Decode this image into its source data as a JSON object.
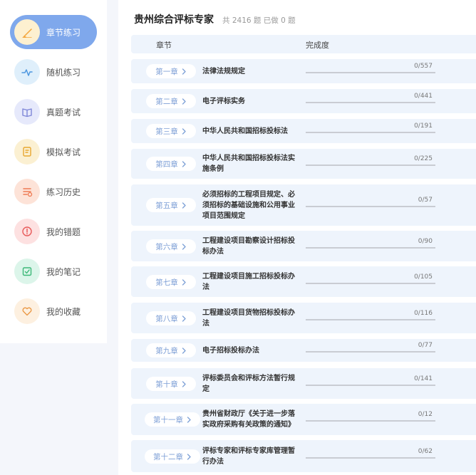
{
  "sidebar": {
    "items": [
      {
        "label": "章节练习",
        "icon": "pencil-icon",
        "active": true,
        "bg": "#fdf0d0",
        "fg": "#f3a43a"
      },
      {
        "label": "随机练习",
        "icon": "pulse-icon",
        "active": false,
        "bg": "#dfeffb",
        "fg": "#4f98e0"
      },
      {
        "label": "真题考试",
        "icon": "book-icon",
        "active": false,
        "bg": "#e6e9fb",
        "fg": "#7e86d8"
      },
      {
        "label": "模拟考试",
        "icon": "edit-document-icon",
        "active": false,
        "bg": "#fbf0d2",
        "fg": "#e8a730"
      },
      {
        "label": "练习历史",
        "icon": "history-list-icon",
        "active": false,
        "bg": "#fde3d8",
        "fg": "#ee7a52"
      },
      {
        "label": "我的错题",
        "icon": "error-icon",
        "active": false,
        "bg": "#fde1e1",
        "fg": "#e85a5a"
      },
      {
        "label": "我的笔记",
        "icon": "note-icon",
        "active": false,
        "bg": "#dcf5ea",
        "fg": "#3cb878"
      },
      {
        "label": "我的收藏",
        "icon": "heart-icon",
        "active": false,
        "bg": "#fdf0e0",
        "fg": "#eb9a48"
      }
    ]
  },
  "header": {
    "title": "贵州综合评标专家",
    "subtitle": "共 2416 题 已做 0 题"
  },
  "table": {
    "col_chapter": "章节",
    "col_progress": "完成度",
    "rows": [
      {
        "chapter": "第一章",
        "name": "法律法规规定",
        "progress": "0/557",
        "done": 0
      },
      {
        "chapter": "第二章",
        "name": "电子评标实务",
        "progress": "0/441",
        "done": 0
      },
      {
        "chapter": "第三章",
        "name": "中华人民共和国招标投标法",
        "progress": "0/191",
        "done": 0
      },
      {
        "chapter": "第四章",
        "name": "中华人民共和国招标投标法实施条例",
        "progress": "0/225",
        "done": 0
      },
      {
        "chapter": "第五章",
        "name": "必须招标的工程项目规定、必须招标的基础设施和公用事业项目范围规定",
        "progress": "0/57",
        "done": 0
      },
      {
        "chapter": "第六章",
        "name": "工程建设项目勘察设计招标投标办法",
        "progress": "0/90",
        "done": 0
      },
      {
        "chapter": "第七章",
        "name": "工程建设项目施工招标投标办法",
        "progress": "0/105",
        "done": 0
      },
      {
        "chapter": "第八章",
        "name": "工程建设项目货物招标投标办法",
        "progress": "0/116",
        "done": 0
      },
      {
        "chapter": "第九章",
        "name": "电子招标投标办法",
        "progress": "0/77",
        "done": 0
      },
      {
        "chapter": "第十章",
        "name": "评标委员会和评标方法暂行规定",
        "progress": "0/141",
        "done": 0
      },
      {
        "chapter": "第十一章",
        "name": "贵州省财政厅《关于进一步落实政府采购有关政策的通知》",
        "progress": "0/12",
        "done": 0
      },
      {
        "chapter": "第十二章",
        "name": "评标专家和评标专家库管理暂行办法",
        "progress": "0/62",
        "done": 0
      }
    ]
  }
}
